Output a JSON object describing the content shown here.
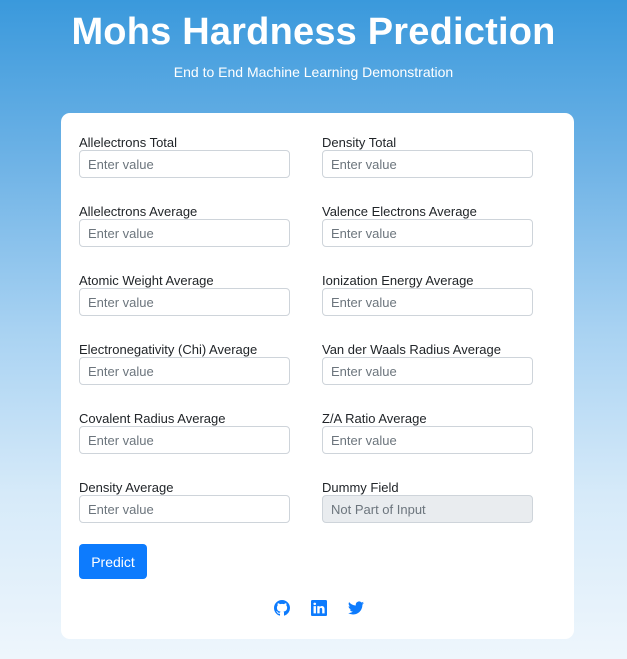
{
  "header": {
    "title": "Mohs Hardness Prediction",
    "subtitle": "End to End Machine Learning Demonstration"
  },
  "form": {
    "fields": [
      {
        "label": "Allelectrons Total",
        "placeholder": "Enter value",
        "value": ""
      },
      {
        "label": "Density Total",
        "placeholder": "Enter value",
        "value": ""
      },
      {
        "label": "Allelectrons Average",
        "placeholder": "Enter value",
        "value": ""
      },
      {
        "label": "Valence Electrons Average",
        "placeholder": "Enter value",
        "value": ""
      },
      {
        "label": "Atomic Weight Average",
        "placeholder": "Enter value",
        "value": ""
      },
      {
        "label": "Ionization Energy Average",
        "placeholder": "Enter value",
        "value": ""
      },
      {
        "label": "Electronegativity (Chi) Average",
        "placeholder": "Enter value",
        "value": ""
      },
      {
        "label": "Van der Waals Radius Average",
        "placeholder": "Enter value",
        "value": ""
      },
      {
        "label": "Covalent Radius Average",
        "placeholder": "Enter value",
        "value": ""
      },
      {
        "label": "Z/A Ratio Average",
        "placeholder": "Enter value",
        "value": ""
      },
      {
        "label": "Density Average",
        "placeholder": "Enter value",
        "value": ""
      },
      {
        "label": "Dummy Field",
        "placeholder": "Not Part of Input",
        "value": "",
        "disabled": true
      }
    ],
    "submit_label": "Predict"
  },
  "socials": [
    {
      "icon": "github-icon"
    },
    {
      "icon": "linkedin-icon"
    },
    {
      "icon": "twitter-icon"
    }
  ],
  "colors": {
    "accent": "#0d7bfd",
    "background_top": "#3a99dc",
    "background_bottom": "#eef6fc",
    "card": "#ffffff",
    "disabled_input": "#e9ecef"
  }
}
